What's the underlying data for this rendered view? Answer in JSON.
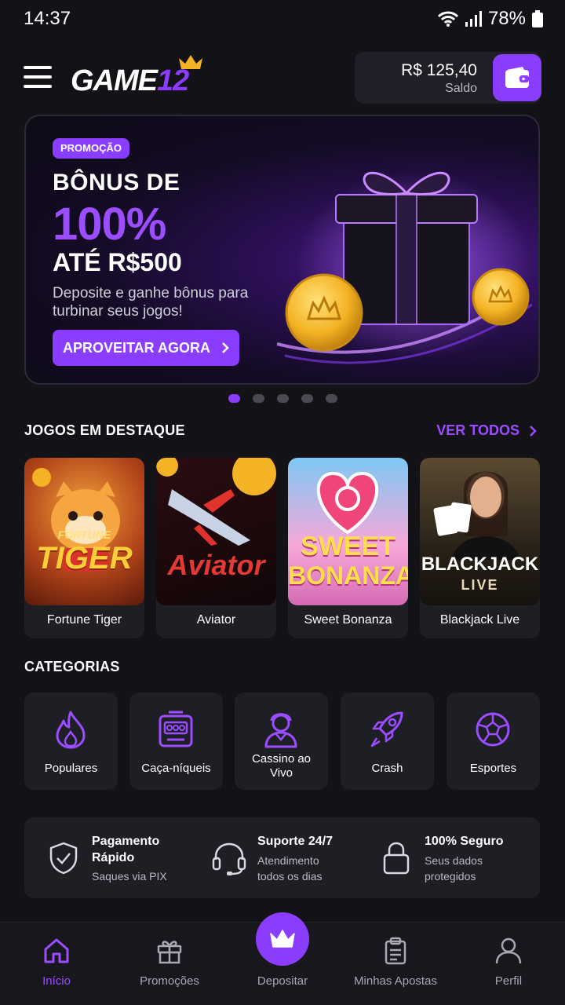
{
  "status_bar": {
    "time": "14:37",
    "battery": "78%",
    "icons": [
      "wifi-icon",
      "signal-icon",
      "battery-icon"
    ]
  },
  "header": {
    "logo": {
      "text": "GAME",
      "number": "12"
    },
    "balance": {
      "amount": "R$ 125,40",
      "label": "Saldo"
    },
    "icons": {
      "menu": "menu-icon",
      "wallet": "wallet-icon"
    }
  },
  "banner": {
    "badge": "PROMOÇÃO",
    "line1": "BÔNUS DE",
    "highlight": "100%",
    "line3": "ATÉ R$500",
    "description": "Deposite e ganhe bônus para turbinar seus jogos!",
    "cta": "APROVEITAR AGORA",
    "slide_count": 5,
    "active_slide": 1
  },
  "featured": {
    "title": "JOGOS EM DESTAQUE",
    "see_all": "VER TODOS",
    "games": [
      {
        "name": "Fortune Tiger",
        "logo": "FORTUNE TIGER"
      },
      {
        "name": "Aviator",
        "logo": "Aviator"
      },
      {
        "name": "Sweet Bonanza",
        "logo": "SWEET BONANZA"
      },
      {
        "name": "Blackjack Live",
        "logo": "BLACKJACK",
        "logo_sub": "LIVE"
      }
    ]
  },
  "categories": {
    "title": "CATEGORIAS",
    "items": [
      {
        "label": "Populares",
        "icon": "flame-icon"
      },
      {
        "label": "Caça-níqueis",
        "icon": "slot-machine-icon"
      },
      {
        "label": "Cassino ao Vivo",
        "icon": "live-dealer-icon"
      },
      {
        "label": "Crash",
        "icon": "rocket-icon"
      },
      {
        "label": "Esportes",
        "icon": "soccer-ball-icon"
      }
    ]
  },
  "features": [
    {
      "title": "Pagamento Rápido",
      "subtitle": "Saques via PIX",
      "icon": "shield-check-icon"
    },
    {
      "title": "Suporte 24/7",
      "subtitle": "Atendimento todos os dias",
      "icon": "headset-icon"
    },
    {
      "title": "100% Seguro",
      "subtitle": "Seus dados protegidos",
      "icon": "lock-icon"
    }
  ],
  "bottom_nav": {
    "active": "Início",
    "items": [
      {
        "label": "Início",
        "icon": "home-icon"
      },
      {
        "label": "Promoções",
        "icon": "gift-icon"
      },
      {
        "label": "Depositar",
        "icon": "crown-icon"
      },
      {
        "label": "Minhas Apostas",
        "icon": "clipboard-icon"
      },
      {
        "label": "Perfil",
        "icon": "user-icon"
      }
    ]
  },
  "colors": {
    "accent": "#8b3dff",
    "background": "#121217",
    "card": "#1e1e25",
    "gold": "#f4b324"
  }
}
